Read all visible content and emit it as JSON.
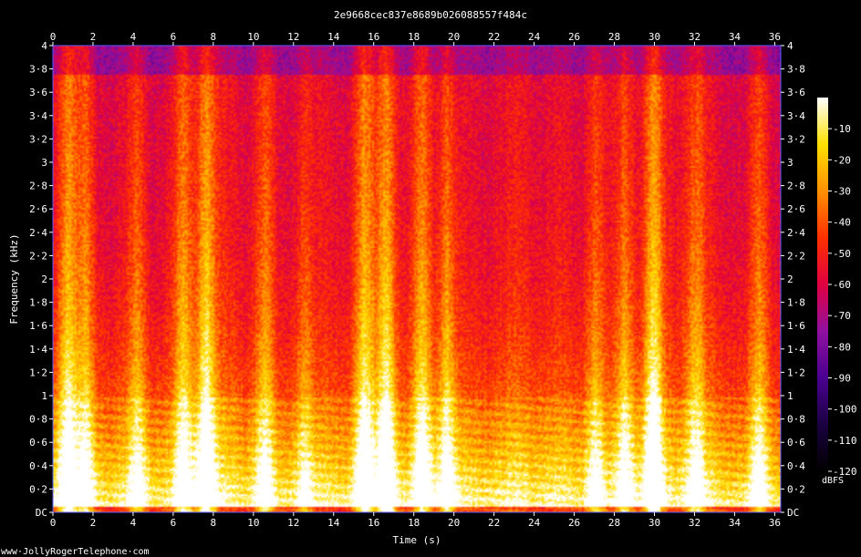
{
  "chart_data": {
    "type": "heatmap",
    "title": "2e9668cec837e8689b026088557f484c",
    "xlabel": "Time (s)",
    "ylabel": "Frequency (kHz)",
    "x_ticks": [
      "0",
      "2",
      "4",
      "6",
      "8",
      "10",
      "12",
      "14",
      "16",
      "18",
      "20",
      "22",
      "24",
      "26",
      "28",
      "30",
      "32",
      "34",
      "36"
    ],
    "y_ticks": [
      "DC",
      "0·2",
      "0·4",
      "0·6",
      "0·8",
      "1",
      "1·2",
      "1·4",
      "1·6",
      "1·8",
      "2",
      "2·2",
      "2·4",
      "2·6",
      "2·8",
      "3",
      "3·2",
      "3·4",
      "3·6",
      "3·8",
      "4"
    ],
    "xlim": [
      0,
      36.3
    ],
    "ylim": [
      0,
      4
    ],
    "colorbar": {
      "label": "dBFS",
      "ticks": [
        "-10",
        "-20",
        "-30",
        "-40",
        "-50",
        "-60",
        "-70",
        "-80",
        "-90",
        "-100",
        "-110",
        "-120"
      ],
      "range": [
        -120,
        0
      ],
      "colors": [
        "#000000",
        "#1a0040",
        "#4a0090",
        "#9010a0",
        "#e00040",
        "#ff3000",
        "#ff9000",
        "#ffe000",
        "#ffffff"
      ]
    },
    "energy_bursts": [
      {
        "t": 0.7,
        "strength": 0.8
      },
      {
        "t": 1.6,
        "strength": 0.6
      },
      {
        "t": 4.2,
        "strength": 0.6
      },
      {
        "t": 6.5,
        "strength": 0.7
      },
      {
        "t": 7.6,
        "strength": 1.0
      },
      {
        "t": 10.5,
        "strength": 0.6
      },
      {
        "t": 12.5,
        "strength": 0.5
      },
      {
        "t": 15.5,
        "strength": 0.8
      },
      {
        "t": 16.6,
        "strength": 1.0
      },
      {
        "t": 18.4,
        "strength": 0.8
      },
      {
        "t": 19.6,
        "strength": 0.8
      },
      {
        "t": 27.0,
        "strength": 0.6
      },
      {
        "t": 28.5,
        "strength": 0.7
      },
      {
        "t": 29.9,
        "strength": 1.0
      },
      {
        "t": 32.0,
        "strength": 0.6
      },
      {
        "t": 35.2,
        "strength": 0.6
      }
    ]
  },
  "footer": {
    "credit": "www·JollyRogerTelephone·com"
  }
}
